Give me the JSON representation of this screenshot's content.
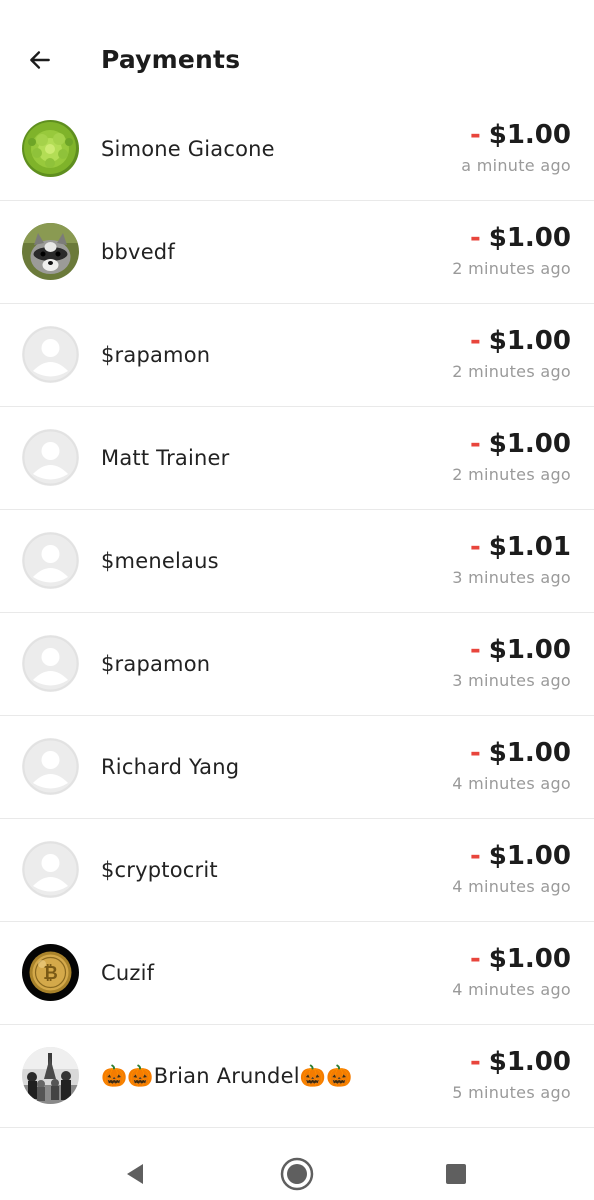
{
  "header": {
    "title": "Payments",
    "back_icon": "arrow-left-icon"
  },
  "payments": [
    {
      "name": "Simone Giacone",
      "sign": "-",
      "amount": "$1.00",
      "time": "a minute ago",
      "avatar": "romanesco-photo"
    },
    {
      "name": "bbvedf",
      "sign": "-",
      "amount": "$1.00",
      "time": "2 minutes ago",
      "avatar": "raccoon-photo"
    },
    {
      "name": "$rapamon",
      "sign": "-",
      "amount": "$1.00",
      "time": "2 minutes ago",
      "avatar": "default-user-icon"
    },
    {
      "name": "Matt Trainer",
      "sign": "-",
      "amount": "$1.00",
      "time": "2 minutes ago",
      "avatar": "default-user-icon"
    },
    {
      "name": "$menelaus",
      "sign": "-",
      "amount": "$1.01",
      "time": "3 minutes ago",
      "avatar": "default-user-icon"
    },
    {
      "name": "$rapamon",
      "sign": "-",
      "amount": "$1.00",
      "time": "3 minutes ago",
      "avatar": "default-user-icon"
    },
    {
      "name": "Richard Yang",
      "sign": "-",
      "amount": "$1.00",
      "time": "4 minutes ago",
      "avatar": "default-user-icon"
    },
    {
      "name": "$cryptocrit",
      "sign": "-",
      "amount": "$1.00",
      "time": "4 minutes ago",
      "avatar": "default-user-icon"
    },
    {
      "name": "Cuzif",
      "sign": "-",
      "amount": "$1.00",
      "time": "4 minutes ago",
      "avatar": "bitcoin-coin-photo"
    },
    {
      "name": "🎃🎃Brian Arundel🎃🎃",
      "sign": "-",
      "amount": "$1.00",
      "time": "5 minutes ago",
      "avatar": "bw-people-photo"
    }
  ],
  "nav": {
    "back_icon": "nav-back-triangle-icon",
    "home_icon": "nav-home-circle-icon",
    "recents_icon": "nav-recents-square-icon"
  },
  "colors": {
    "minus": "#e8453c",
    "amount": "#1c1c1c",
    "timestamp": "#9a9a9a",
    "divider": "#e9e9e9",
    "avatar_placeholder": "#ececec"
  }
}
